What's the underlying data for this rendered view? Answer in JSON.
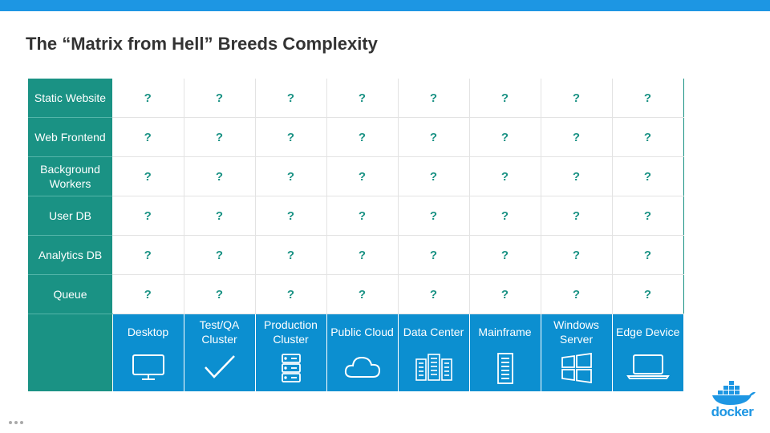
{
  "slide": {
    "title": "The “Matrix from Hell” Breeds Complexity",
    "accent_color": "#1D96E3",
    "row_color": "#1A9284",
    "platform_color": "#0C8FD0"
  },
  "matrix": {
    "rows": [
      "Static Website",
      "Web Frontend",
      "Background Workers",
      "User DB",
      "Analytics DB",
      "Queue"
    ],
    "cell_value": "?",
    "platforms": [
      {
        "label": "Desktop",
        "icon": "desktop-icon"
      },
      {
        "label": "Test/QA Cluster",
        "icon": "checkmark-icon"
      },
      {
        "label": "Production Cluster",
        "icon": "server-rack-icon"
      },
      {
        "label": "Public Cloud",
        "icon": "cloud-icon"
      },
      {
        "label": "Data Center",
        "icon": "data-center-icon"
      },
      {
        "label": "Mainframe",
        "icon": "mainframe-icon"
      },
      {
        "label": "Windows Server",
        "icon": "windows-icon"
      },
      {
        "label": "Edge Device",
        "icon": "laptop-icon"
      }
    ]
  },
  "logo": {
    "text": "docker",
    "icon": "docker-whale-icon"
  }
}
